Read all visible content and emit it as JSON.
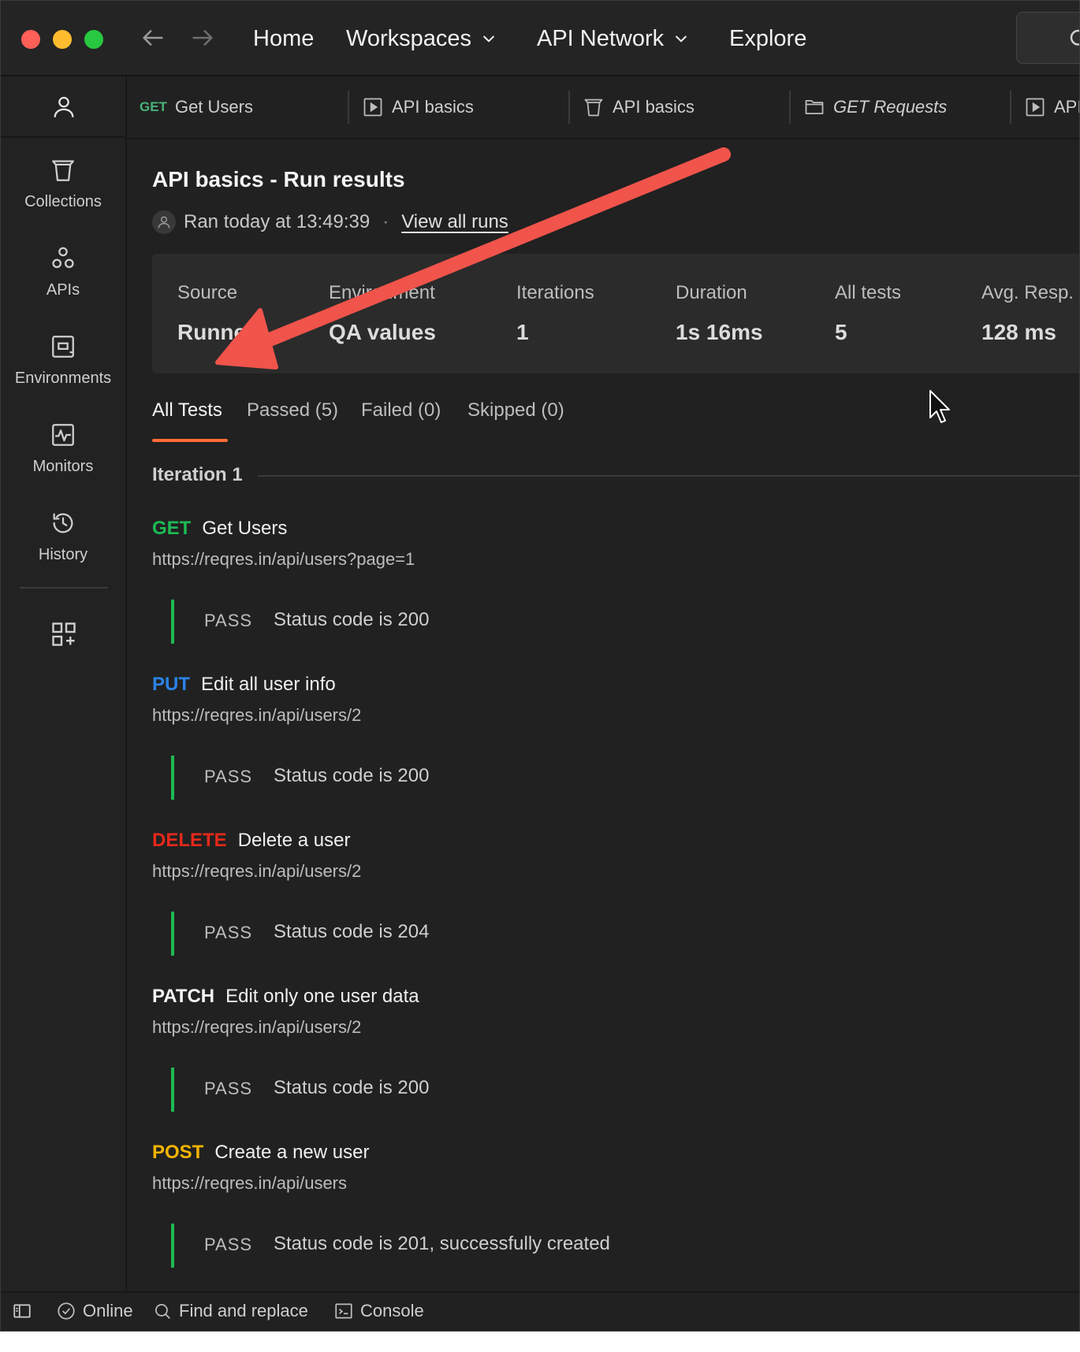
{
  "titlebar": {
    "nav": [
      {
        "label": "Home",
        "has_dropdown": false
      },
      {
        "label": "Workspaces",
        "has_dropdown": true
      },
      {
        "label": "API Network",
        "has_dropdown": true
      },
      {
        "label": "Explore",
        "has_dropdown": false
      }
    ]
  },
  "sidebar": {
    "items": [
      {
        "label": "Collections",
        "icon": "collections-icon"
      },
      {
        "label": "APIs",
        "icon": "apis-icon"
      },
      {
        "label": "Environments",
        "icon": "environments-icon"
      },
      {
        "label": "Monitors",
        "icon": "monitors-icon"
      },
      {
        "label": "History",
        "icon": "history-icon"
      }
    ]
  },
  "tabs": [
    {
      "method": "GET",
      "label": "Get Users",
      "icon": ""
    },
    {
      "method": "",
      "label": "API basics",
      "icon": "runner-icon"
    },
    {
      "method": "",
      "label": "API basics",
      "icon": "collection-icon"
    },
    {
      "method": "",
      "label": "GET Requests",
      "icon": "folder-icon"
    },
    {
      "method": "",
      "label": "API",
      "icon": "runner-icon"
    }
  ],
  "run": {
    "title": "API basics - Run results",
    "ran_at": "Ran today at 13:49:39",
    "separator": "·",
    "view_all": "View all runs",
    "summary": [
      {
        "key": "Source",
        "value": "Runner"
      },
      {
        "key": "Environment",
        "value": "QA values"
      },
      {
        "key": "Iterations",
        "value": "1"
      },
      {
        "key": "Duration",
        "value": "1s 16ms"
      },
      {
        "key": "All tests",
        "value": "5"
      },
      {
        "key": "Avg. Resp.",
        "value": "128 ms"
      }
    ],
    "filter_tabs": [
      {
        "label": "All Tests",
        "active": true
      },
      {
        "label": "Passed (5)",
        "active": false
      },
      {
        "label": "Failed (0)",
        "active": false
      },
      {
        "label": "Skipped (0)",
        "active": false
      }
    ],
    "iteration_label": "Iteration 1",
    "requests": [
      {
        "method": "GET",
        "method_color": "#1db954",
        "name": "Get Users",
        "url": "https://reqres.in/api/users?page=1",
        "status": "PASS",
        "test": "Status code is 200"
      },
      {
        "method": "PUT",
        "method_color": "#2b82e8",
        "name": "Edit all user info",
        "url": "https://reqres.in/api/users/2",
        "status": "PASS",
        "test": "Status code is 200"
      },
      {
        "method": "DELETE",
        "method_color": "#e5291b",
        "name": "Delete a user",
        "url": "https://reqres.in/api/users/2",
        "status": "PASS",
        "test": "Status code is 204"
      },
      {
        "method": "PATCH",
        "method_color": "#f5f5f5",
        "name": "Edit only one user data",
        "url": "https://reqres.in/api/users/2",
        "status": "PASS",
        "test": "Status code is 200"
      },
      {
        "method": "POST",
        "method_color": "#f5b400",
        "name": "Create a new user",
        "url": "https://reqres.in/api/users",
        "status": "PASS",
        "test": "Status code is 201, successfully created"
      }
    ]
  },
  "statusbar": {
    "online": "Online",
    "find_replace": "Find and replace",
    "console": "Console"
  },
  "colors": {
    "background": "#212121",
    "accent": "#ff6c37",
    "pass": "#1db954",
    "annotation_arrow": "#f0544b"
  }
}
